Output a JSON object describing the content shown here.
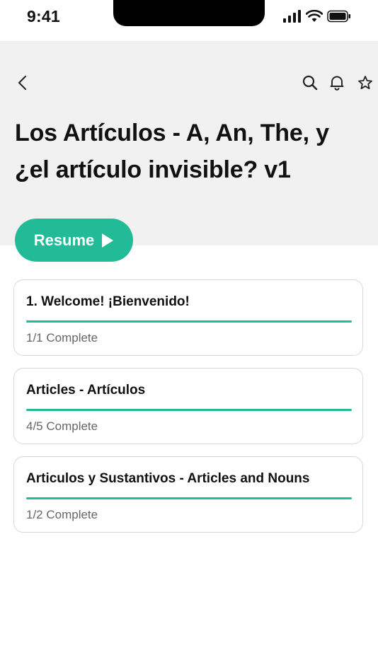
{
  "status_bar": {
    "time": "9:41"
  },
  "header": {
    "title": "Los Artículos - A, An, The, y ¿el artículo invisible? v1",
    "icons": [
      "back-chevron-icon",
      "search-icon",
      "bell-icon",
      "star-icon"
    ]
  },
  "resume": {
    "label": "Resume"
  },
  "accent_color": "#22bb98",
  "lessons": [
    {
      "title": "1. Welcome! ¡Bienvenido!",
      "status": "1/1 Complete",
      "progress": 1.0
    },
    {
      "title": "Articles - Artículos",
      "status": "4/5 Complete",
      "progress": 1.0
    },
    {
      "title": "Articulos y Sustantivos - Articles and Nouns",
      "status": "1/2 Complete",
      "progress": 1.0
    }
  ]
}
